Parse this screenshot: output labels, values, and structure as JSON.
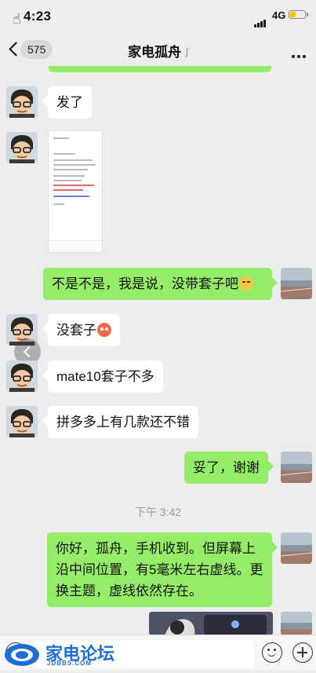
{
  "status_bar": {
    "time": "4:23",
    "network": "4G"
  },
  "nav": {
    "back_count": "575",
    "title": "家电孤舟"
  },
  "messages": {
    "m1": "发了",
    "m3": "不是不是，我是说，没带套子吧",
    "m4": "没套子",
    "m5": "mate10套子不多",
    "m6": "拼多多上有几款还不错",
    "m7": "妥了，谢谢",
    "timestamp": "下午 3:42",
    "m8": "你好，孤舟，手机收到。但屏幕上沿中间位置，有5毫米左右虚线。更换主题，虚线依然存在。"
  },
  "icons": {
    "back": "chevron-left-icon",
    "ear": "ear-icon",
    "more": "more-dots-icon",
    "voice": "voice-icon",
    "emoji": "emoji-icon",
    "plus": "plus-icon",
    "emoji_sly": "sly-face-emoji",
    "emoji_angry": "angry-face-emoji"
  },
  "watermark": {
    "text": "家电论坛",
    "sub": "JDBBS.COM"
  },
  "colors": {
    "sent_bubble": "#95ec69",
    "received_bubble": "#ffffff",
    "background": "#ededed"
  }
}
